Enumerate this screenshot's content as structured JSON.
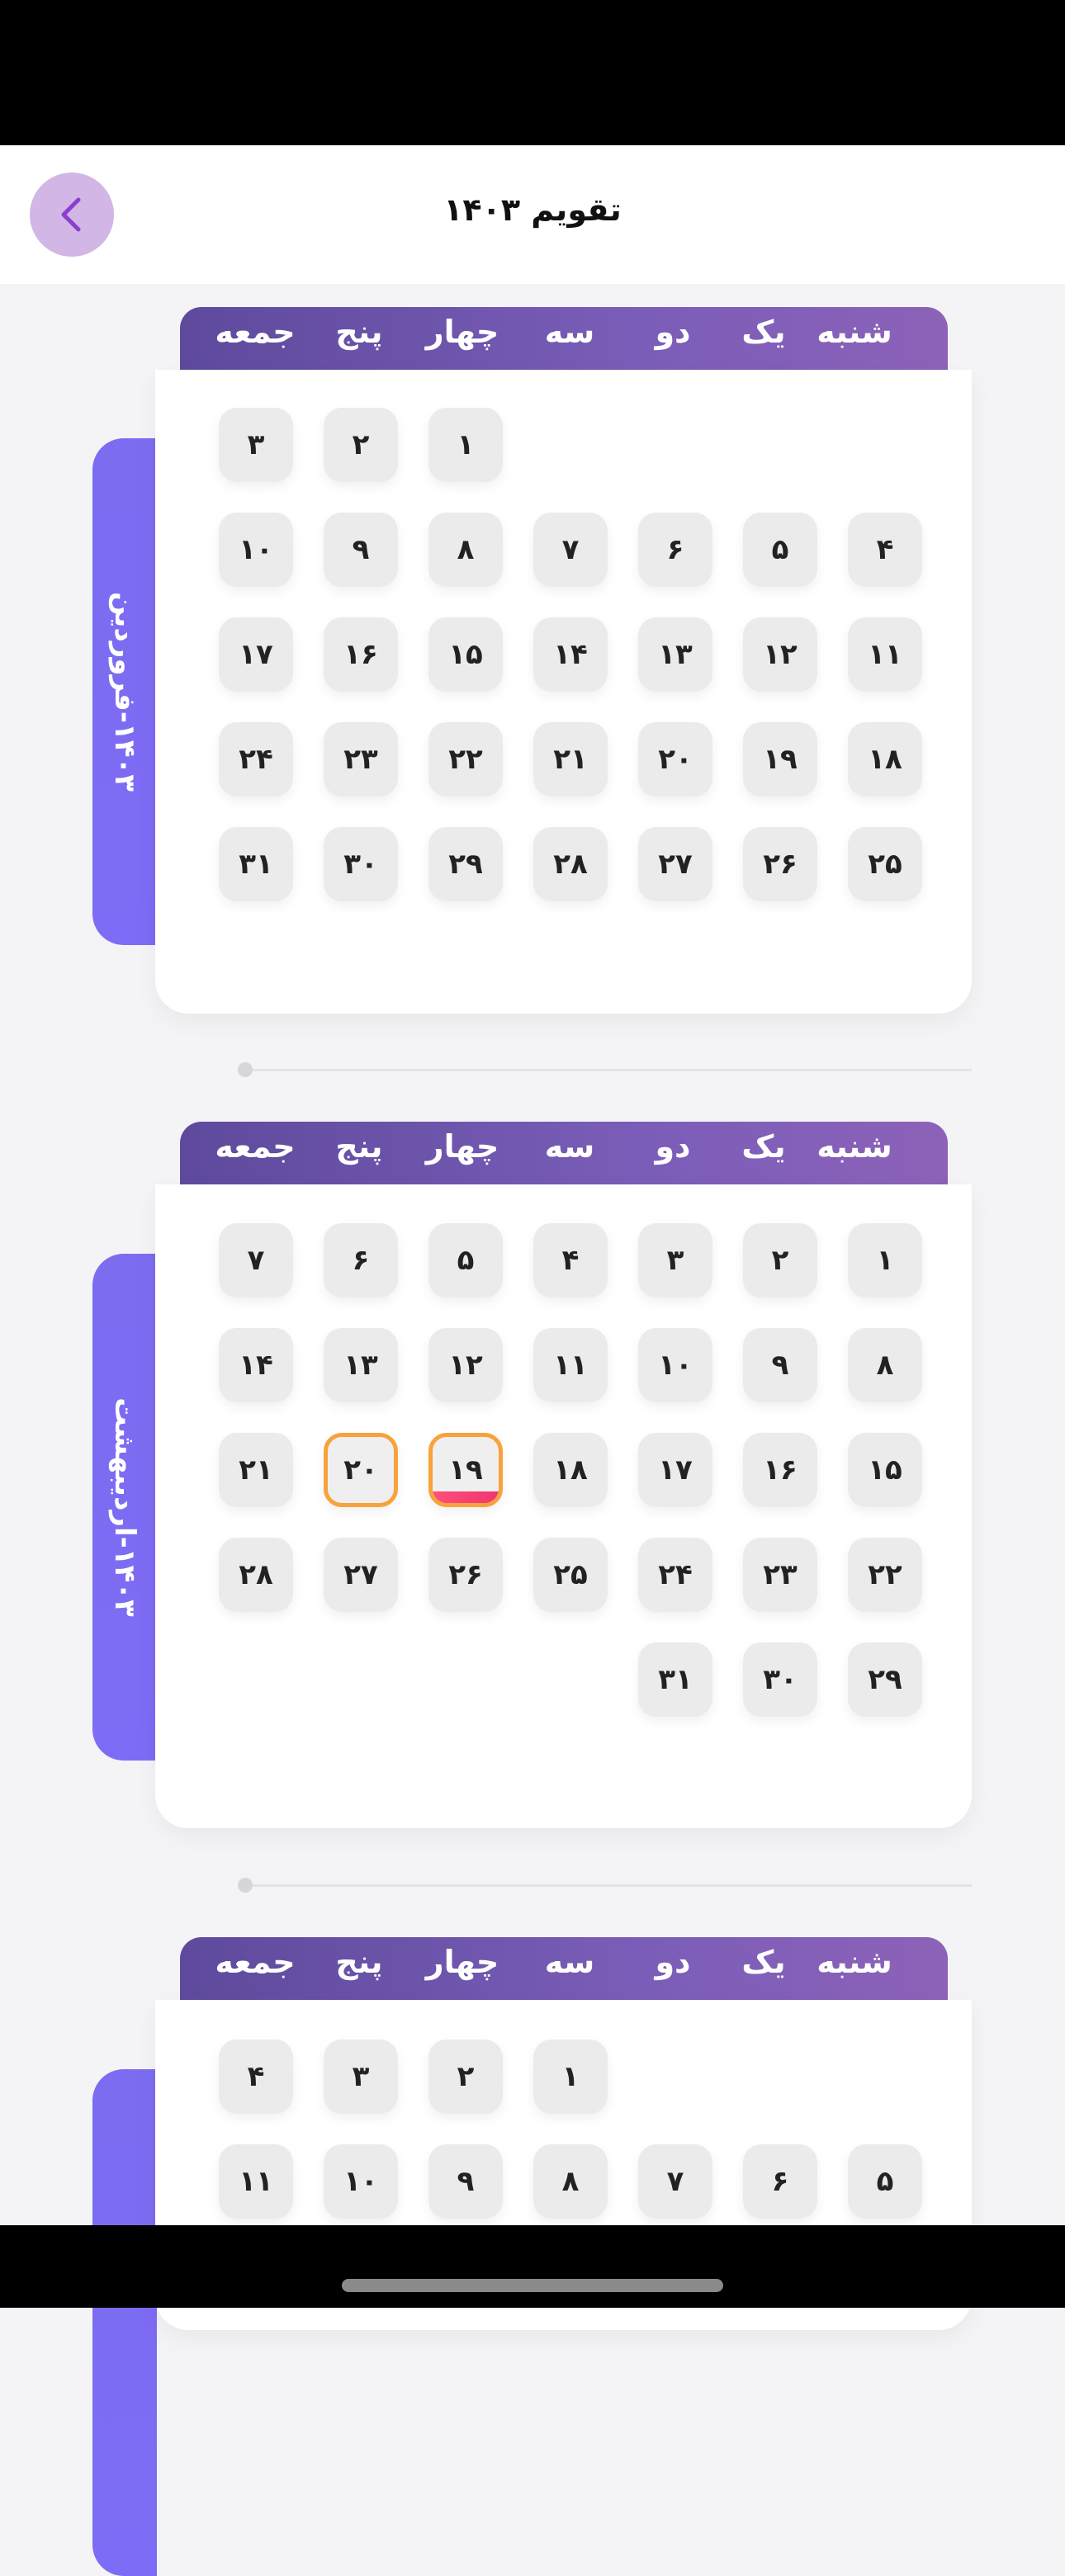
{
  "header": {
    "title": "تقویم ۱۴۰۳"
  },
  "weekdays": [
    "شنبه",
    "یک",
    "دو",
    "سه",
    "چهار",
    "پنج",
    "جمعه"
  ],
  "months": [
    {
      "label": "۱۴۰۳-فروردین",
      "days": [
        "۱",
        "۲",
        "۳",
        "۴",
        "۵",
        "۶",
        "۷",
        "۸",
        "۹",
        "۱۰",
        "۱۱",
        "۱۲",
        "۱۳",
        "۱۴",
        "۱۵",
        "۱۶",
        "۱۷",
        "۱۸",
        "۱۹",
        "۲۰",
        "۲۱",
        "۲۲",
        "۲۳",
        "۲۴",
        "۲۵",
        "۲۶",
        "۲۷",
        "۲۸",
        "۲۹",
        "۳۰",
        "۳۱"
      ]
    },
    {
      "label": "۱۴۰۳-اردیبهشت",
      "days": [
        "۱",
        "۲",
        "۳",
        "۴",
        "۵",
        "۶",
        "۷",
        "۸",
        "۹",
        "۱۰",
        "۱۱",
        "۱۲",
        "۱۳",
        "۱۴",
        "۱۵",
        "۱۶",
        "۱۷",
        "۱۸",
        "۱۹",
        "۲۰",
        "۲۱",
        "۲۲",
        "۲۳",
        "۲۴",
        "۲۵",
        "۲۶",
        "۲۷",
        "۲۸",
        "۲۹",
        "۳۰",
        "۳۱"
      ],
      "selected_days": [
        "۱۹",
        "۲۰"
      ],
      "today": "۱۹"
    },
    {
      "label": "",
      "days": [
        "۱",
        "۲",
        "۳",
        "۴",
        "۵",
        "۶",
        "۷",
        "۸",
        "۹",
        "۱۰",
        "۱۱"
      ]
    }
  ],
  "colors": {
    "accent": "#7c6cf0",
    "selected_border": "#f7a23b",
    "today_bar": "#f0356f"
  }
}
